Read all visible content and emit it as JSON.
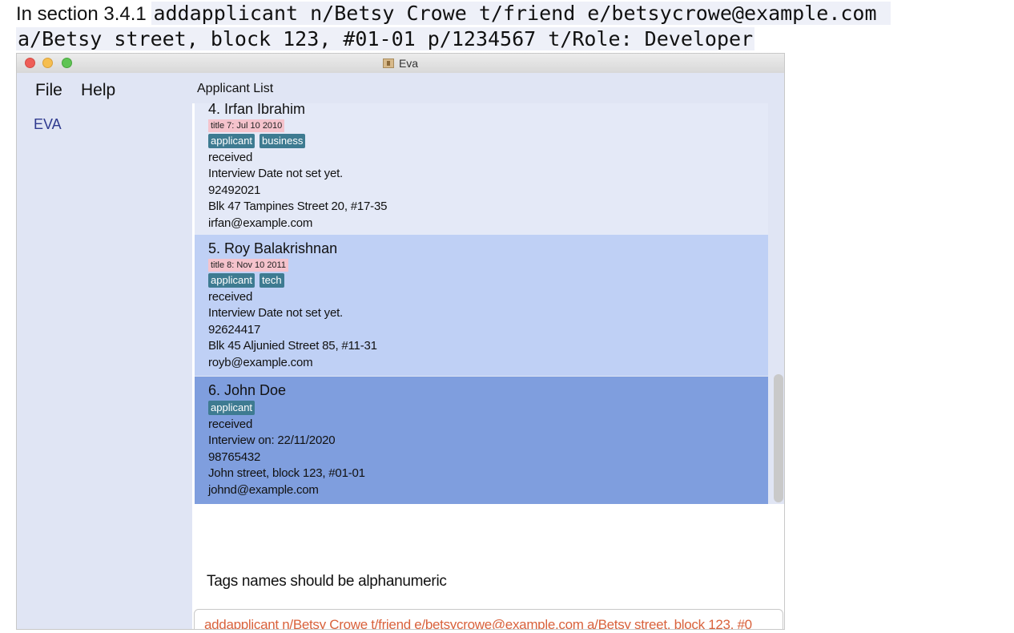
{
  "caption": {
    "label": "In section 3.4.1 ",
    "code_line1": "addapplicant n/Betsy Crowe t/friend e/betsycrowe@example.com ",
    "code_line2": "a/Betsy street, block 123, #01-01 p/1234567 t/Role: Developer"
  },
  "window": {
    "title": "Eva",
    "icon": "app-icon"
  },
  "menu": {
    "file": "File",
    "help": "Help"
  },
  "sidebar": {
    "items": [
      {
        "label": "EVA"
      }
    ]
  },
  "list": {
    "header": "Applicant List",
    "cards": [
      {
        "name": "4.  Irfan Ibrahim",
        "date_tag": "title 7: Jul 10 2010",
        "tags": [
          "applicant",
          "business"
        ],
        "status": "received",
        "interview": "Interview Date not set yet.",
        "phone": "92492021",
        "address": "Blk 47 Tampines Street 20, #17-35",
        "email": "irfan@example.com"
      },
      {
        "name": "5.  Roy Balakrishnan",
        "date_tag": "title 8: Nov 10 2011",
        "tags": [
          "applicant",
          "tech"
        ],
        "status": "received",
        "interview": "Interview Date not set yet.",
        "phone": "92624417",
        "address": "Blk 45 Aljunied Street 85, #11-31",
        "email": "royb@example.com"
      },
      {
        "name": "6.  John Doe",
        "tags": [
          "applicant"
        ],
        "status": "received",
        "interview": "Interview on: 22/11/2020",
        "phone": "98765432",
        "address": "John street, block 123, #01-01",
        "email": "johnd@example.com"
      }
    ]
  },
  "result": {
    "message": "Tags names should be alphanumeric"
  },
  "command": {
    "value": "addapplicant n/Betsy Crowe t/friend e/betsycrowe@example.com a/Betsy street, block 123, #0"
  },
  "colors": {
    "selected_card": "#7f9ede",
    "hover_card": "#bfd0f5",
    "tag": "#3e7b91",
    "date_tag": "#f5c3cc",
    "command_text": "#d9623c"
  }
}
